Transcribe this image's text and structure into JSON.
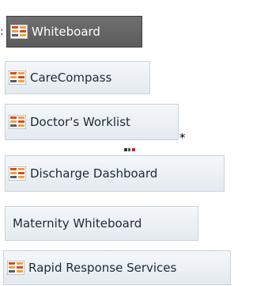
{
  "tabs": [
    {
      "label": "Whiteboard",
      "icon": "whiteboard-grid-icon",
      "selected": true
    },
    {
      "label": "CareCompass",
      "icon": "whiteboard-grid-icon",
      "selected": false
    },
    {
      "label": "Doctor's Worklist",
      "icon": "whiteboard-grid-icon",
      "selected": false
    },
    {
      "label": "Discharge Dashboard",
      "icon": "whiteboard-grid-icon",
      "selected": false
    },
    {
      "label": "Maternity Whiteboard",
      "icon": null,
      "selected": false
    },
    {
      "label": "Rapid Response Services",
      "icon": "whiteboard-grid-icon",
      "selected": false
    }
  ],
  "marks": {
    "asterisk": "*"
  },
  "colors": {
    "selected_bg": "#666666",
    "button_bg": "#e8edf2",
    "icon_red": "#d64b2a",
    "icon_orange": "#f0a23a",
    "icon_dark": "#5b5b6b"
  }
}
